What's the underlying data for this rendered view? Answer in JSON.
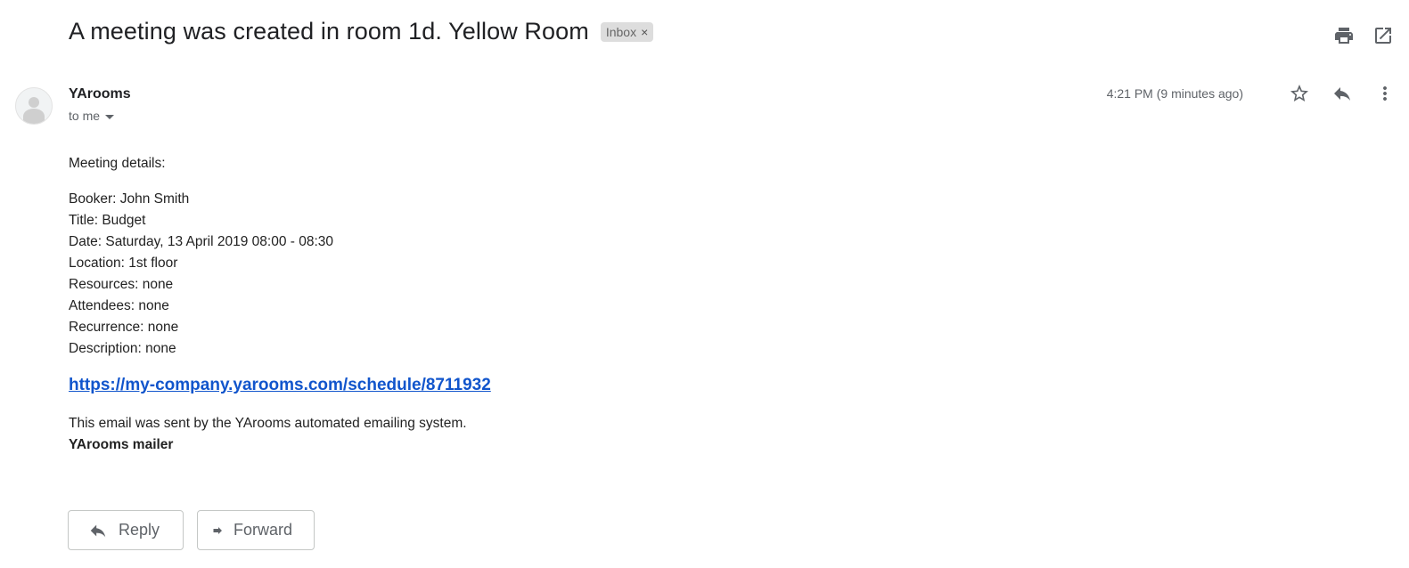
{
  "email": {
    "subject": "A meeting was created in room 1d. Yellow Room",
    "label_chip": "Inbox",
    "label_chip_close": "×",
    "sender_name": "YArooms",
    "recipient": "to me",
    "timestamp": "4:21 PM (9 minutes ago)"
  },
  "body": {
    "intro": "Meeting details:",
    "details": [
      "Booker: John Smith",
      "Title: Budget",
      "Date: Saturday, 13 April 2019 08:00 - 08:30",
      "Location: 1st floor",
      "Resources: none",
      "Attendees: none",
      "Recurrence: none",
      "Description: none"
    ],
    "link": "https://my-company.yarooms.com/schedule/8711932",
    "footer": "This email was sent by the YArooms automated emailing system.",
    "signature": "YArooms mailer"
  },
  "actions": {
    "reply_label": "Reply",
    "forward_label": "Forward"
  },
  "icons": {
    "print": "print-icon",
    "open_new_window": "open-in-new-window-icon",
    "star": "star-icon",
    "reply": "reply-icon",
    "more": "more-vert-icon",
    "avatar": "default-avatar-icon",
    "forward": "forward-icon"
  },
  "colors": {
    "link": "#1155cc",
    "chip_bg": "#dddddd",
    "icon": "#5f6368"
  }
}
